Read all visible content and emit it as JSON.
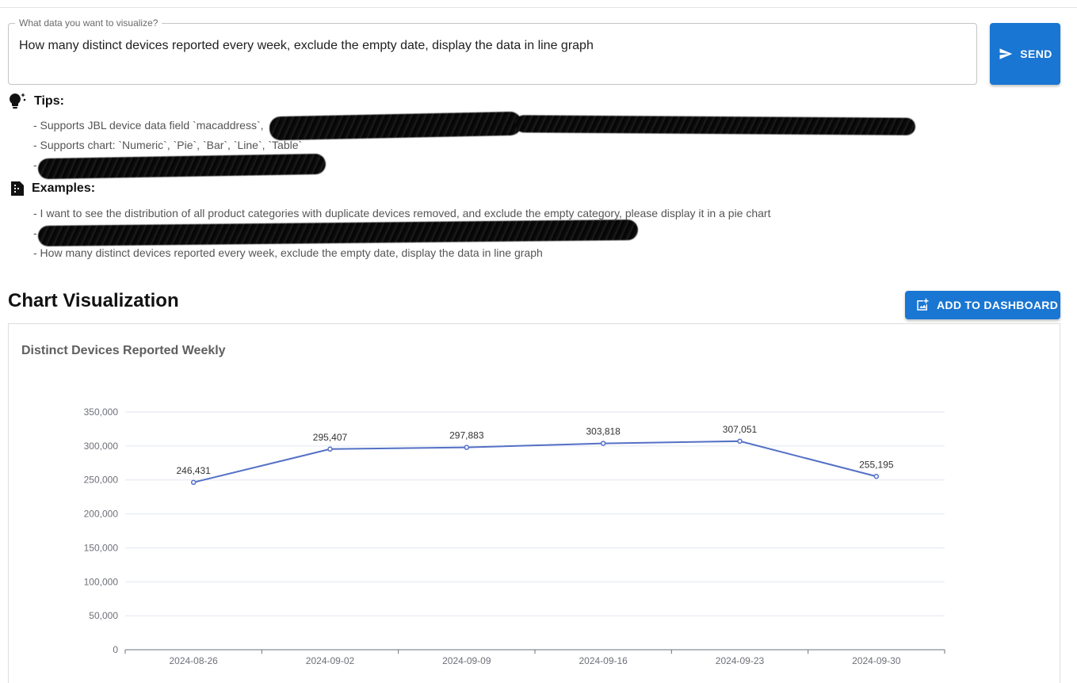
{
  "query": {
    "label": "What data you want to visualize?",
    "value": "How many distinct devices reported every week, exclude the empty date, display the data in line graph"
  },
  "send_button": {
    "label": "SEND",
    "icon": "send-icon"
  },
  "tips": {
    "title": "Tips:",
    "icon": "lightbulb-icon",
    "items": [
      "- Supports JBL device data field `macaddress`,",
      "- Supports chart: `Numeric`, `Pie`, `Bar`, `Line`, `Table`",
      "-"
    ]
  },
  "examples": {
    "title": "Examples:",
    "icon": "document-icon",
    "items": [
      "- I want to see the distribution of all product categories with duplicate devices removed, and exclude the empty category, please display it in a pie chart",
      "-",
      "- How many distinct devices reported every week, exclude the empty date, display the data in line graph"
    ]
  },
  "chart_section": {
    "title": "Chart Visualization",
    "add_button": {
      "label": "ADD TO DASHBOARD",
      "icon": "add-photo-icon"
    }
  },
  "colors": {
    "accent": "#1976d2",
    "series": "#5470c6"
  },
  "chart_data": {
    "type": "line",
    "title": "Distinct Devices Reported Weekly",
    "xlabel": "",
    "ylabel": "",
    "categories": [
      "2024-08-26",
      "2024-09-02",
      "2024-09-09",
      "2024-09-16",
      "2024-09-23",
      "2024-09-30"
    ],
    "values": [
      246431,
      295407,
      297883,
      303818,
      307051,
      255195
    ],
    "data_labels": [
      "246,431",
      "295,407",
      "297,883",
      "303,818",
      "307,051",
      "255,195"
    ],
    "ylim": [
      0,
      350000
    ],
    "y_ticks": [
      0,
      50000,
      100000,
      150000,
      200000,
      250000,
      300000,
      350000
    ],
    "y_tick_labels": [
      "0",
      "50,000",
      "100,000",
      "150,000",
      "200,000",
      "250,000",
      "300,000",
      "350,000"
    ],
    "grid": true,
    "legend": "none"
  }
}
